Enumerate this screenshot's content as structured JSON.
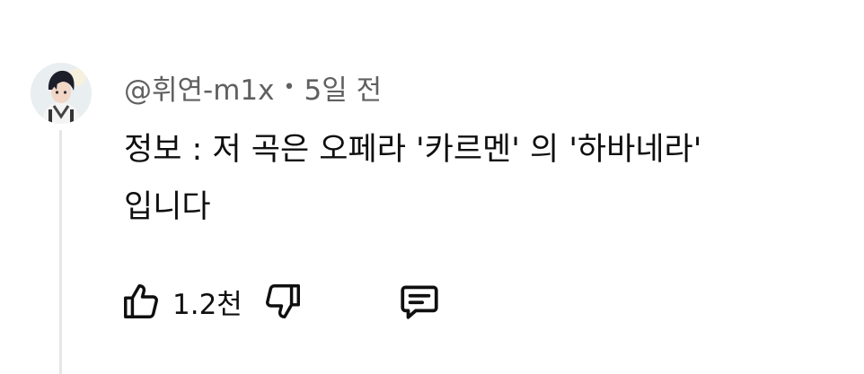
{
  "comment": {
    "author": "@휘연-m1x",
    "separator": "•",
    "time": "5일 전",
    "text_line1": "정보 : 저 곡은 오페라 '카르멘' 의 '하바네라'",
    "text_line2": "입니다"
  },
  "actions": {
    "like_icon": "thumbs-up-icon",
    "like_count": "1.2천",
    "dislike_icon": "thumbs-down-icon",
    "reply_icon": "comment-icon"
  },
  "colors": {
    "primary_text": "#0f0f0f",
    "secondary_text": "#606060",
    "thread_line": "#e6e6e6"
  }
}
